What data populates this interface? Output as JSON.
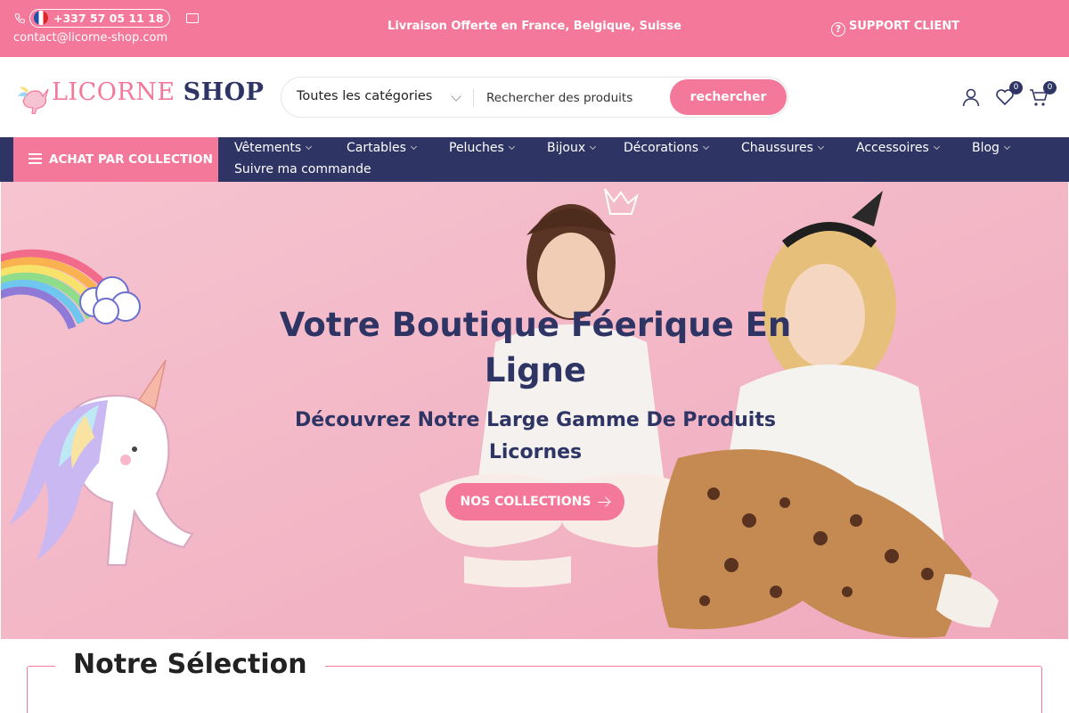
{
  "topbar": {
    "phone": "+337 57 05 11 18",
    "email": "contact@licorne-shop.com",
    "shipping": "Livraison Offerte en France, Belgique, Suisse",
    "support": "SUPPORT CLIENT"
  },
  "header": {
    "logo_left": "LICORNE",
    "logo_right": "SHOP",
    "category_select": "Toutes les catégories",
    "search_placeholder": "Rechercher des produits",
    "search_button": "rechercher",
    "wishlist_count": "0",
    "cart_count": "0"
  },
  "nav": {
    "collection_button": "ACHAT PAR COLLECTION",
    "items": [
      {
        "label": "Vêtements"
      },
      {
        "label": "Cartables"
      },
      {
        "label": "Peluches"
      },
      {
        "label": "Bijoux"
      },
      {
        "label": "Décorations"
      },
      {
        "label": "Chaussures"
      },
      {
        "label": "Accessoires"
      },
      {
        "label": "Blog"
      }
    ],
    "track_order": "Suivre ma commande"
  },
  "hero": {
    "title": "Votre Boutique Féerique En Ligne",
    "subtitle": "Découvrez Notre Large Gamme De Produits Licornes",
    "button": "NOS COLLECTIONS"
  },
  "section": {
    "title": "Notre Sélection"
  },
  "colors": {
    "accent_pink": "#f4789a",
    "navy": "#2e3464"
  }
}
